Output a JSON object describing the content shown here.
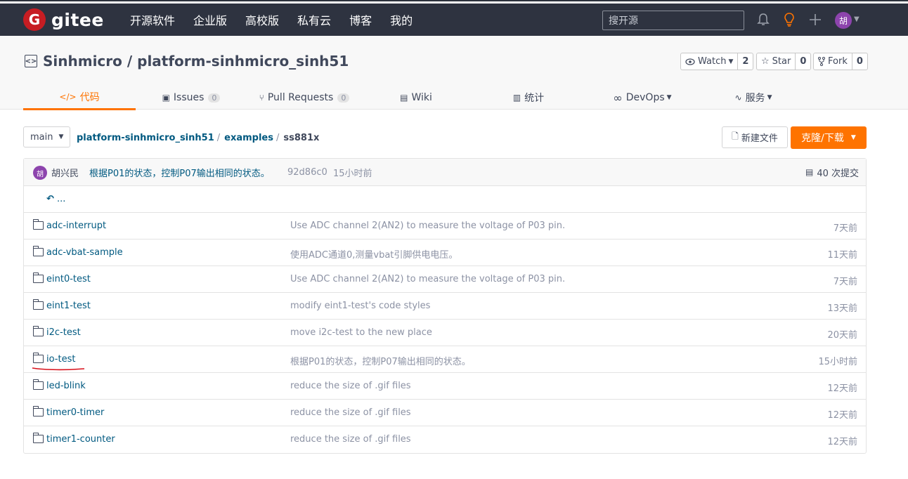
{
  "navbar": {
    "logo_letter": "G",
    "logo_text": "gitee",
    "items": [
      "开源软件",
      "企业版",
      "高校版",
      "私有云",
      "博客",
      "我的"
    ],
    "search_placeholder": "搜开源",
    "avatar_text": "胡"
  },
  "repo": {
    "title": "Sinhmicro / platform-sinhmicro_sinh51",
    "watch_label": "Watch",
    "watch_count": "2",
    "star_label": "Star",
    "star_count": "0",
    "fork_label": "Fork",
    "fork_count": "0"
  },
  "tabs": [
    {
      "label": "代码"
    },
    {
      "label": "Issues",
      "badge": "0"
    },
    {
      "label": "Pull Requests",
      "badge": "0"
    },
    {
      "label": "Wiki"
    },
    {
      "label": "统计"
    },
    {
      "label": "DevOps"
    },
    {
      "label": "服务"
    }
  ],
  "toolbar": {
    "branch": "main",
    "breadcrumb": [
      "platform-sinhmicro_sinh51",
      "examples",
      "ss881x"
    ],
    "new_file_label": "新建文件",
    "clone_label": "克隆/下载"
  },
  "commit": {
    "avatar_text": "胡",
    "author": "胡兴民",
    "message": "根据P01的状态，控制P07输出相同的状态。",
    "sha": "92d86c0",
    "time": "15小时前",
    "count_label": "40 次提交"
  },
  "back_label": "...",
  "files": [
    {
      "name": "adc-interrupt",
      "message": "Use ADC channel 2(AN2) to measure the voltage of P03 pin.",
      "time": "7天前"
    },
    {
      "name": "adc-vbat-sample",
      "message": "使用ADC通道0,测量vbat引脚供电电压。",
      "time": "11天前"
    },
    {
      "name": "eint0-test",
      "message": "Use ADC channel 2(AN2) to measure the voltage of P03 pin.",
      "time": "7天前"
    },
    {
      "name": "eint1-test",
      "message": "modify eint1-test's code styles",
      "time": "13天前"
    },
    {
      "name": "i2c-test",
      "message": "move i2c-test to the new place",
      "time": "20天前"
    },
    {
      "name": "io-test",
      "message": "根据P01的状态，控制P07输出相同的状态。",
      "time": "15小时前"
    },
    {
      "name": "led-blink",
      "message": "reduce the size of .gif files",
      "time": "12天前"
    },
    {
      "name": "timer0-timer",
      "message": "reduce the size of .gif files",
      "time": "12天前"
    },
    {
      "name": "timer1-counter",
      "message": "reduce the size of .gif files",
      "time": "12天前"
    }
  ],
  "colors": {
    "navbar_bg": "#2e3340",
    "accent": "#fe7300",
    "link": "#005980",
    "brand_red": "#c71d23",
    "annotation_red": "#d8101a"
  }
}
